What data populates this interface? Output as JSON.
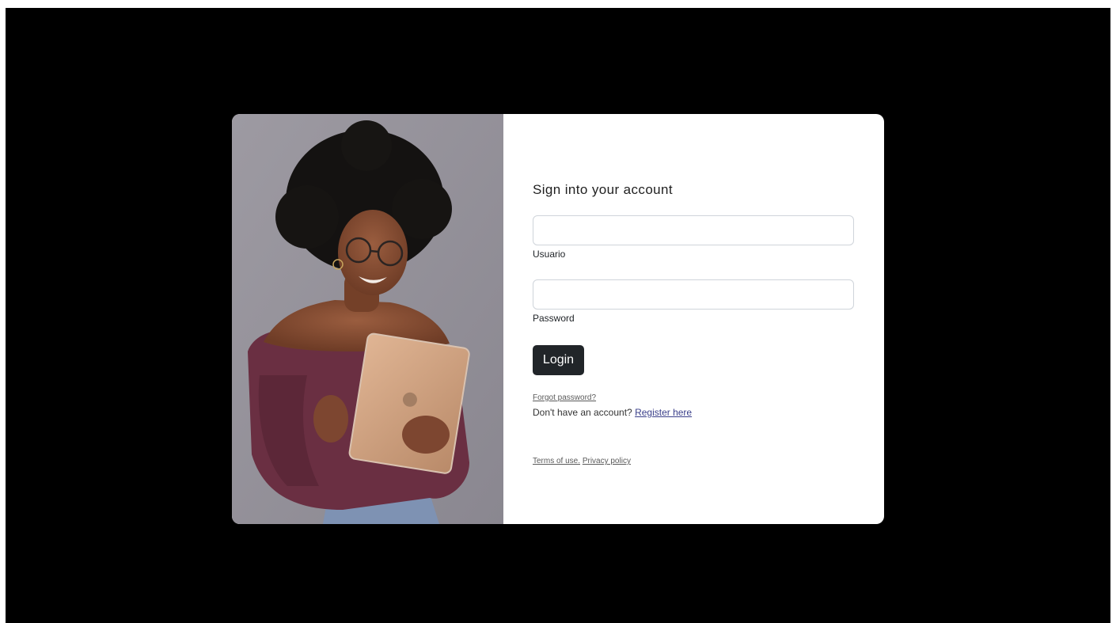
{
  "login_form": {
    "title": "Sign into your account",
    "username_label": "Usuario",
    "username_value": "",
    "password_label": "Password",
    "password_value": "",
    "login_button": "Login",
    "forgot_password": "Forgot password?",
    "no_account_text": "Don't have an account?",
    "register_link": "Register here",
    "terms_link": "Terms of use.",
    "privacy_link": "Privacy policy"
  },
  "colors": {
    "page_background": "#000000",
    "card_background": "#ffffff",
    "button_background": "#212529",
    "link_color": "#3a3f8a"
  }
}
